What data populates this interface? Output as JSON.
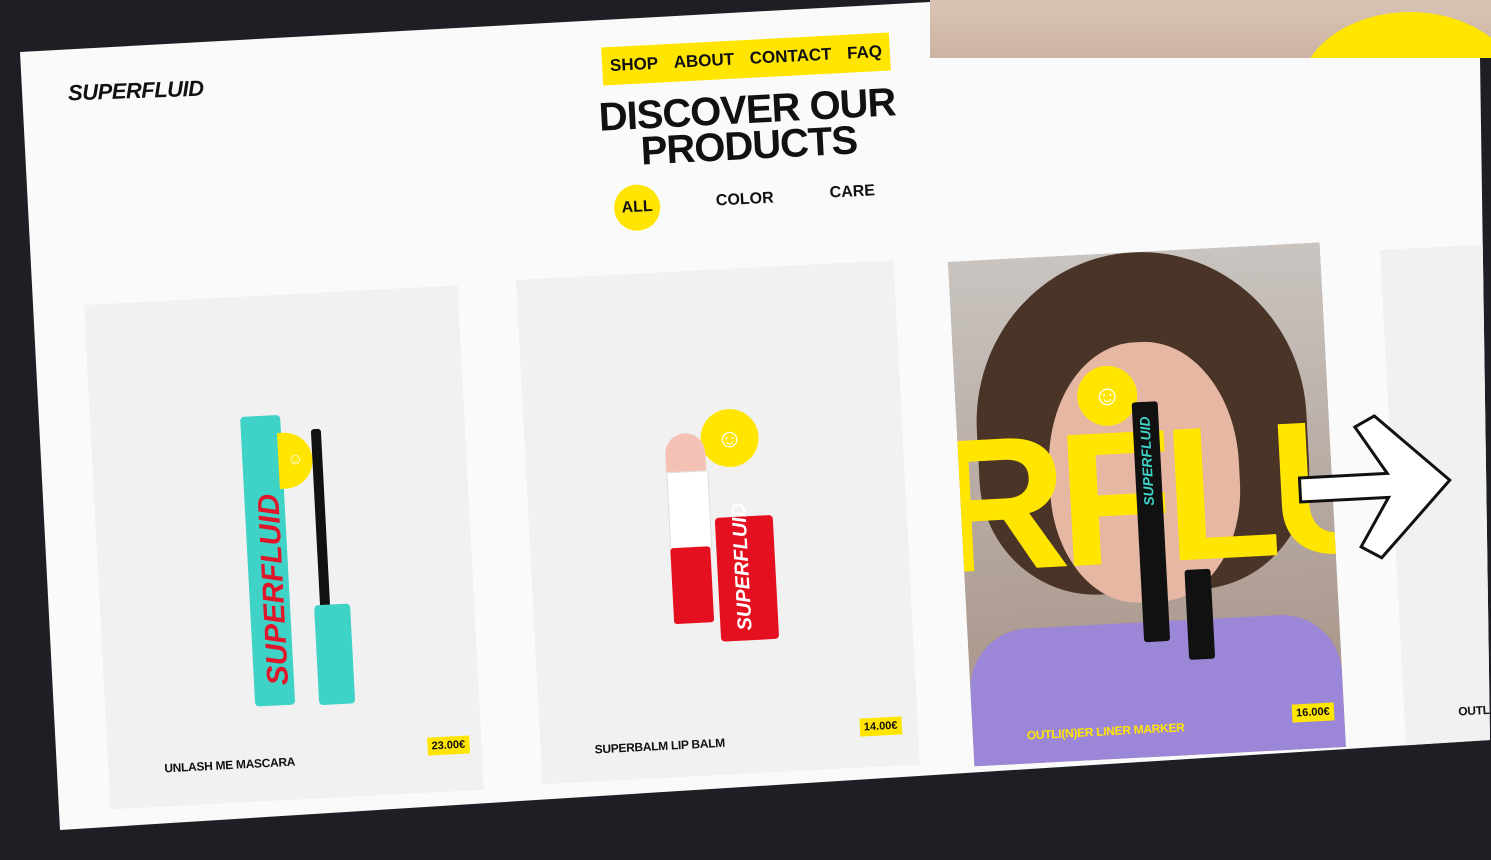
{
  "brand": {
    "logo": "SUPERFLUID"
  },
  "nav": {
    "items": [
      "SHOP",
      "ABOUT",
      "CONTACT",
      "FAQ"
    ]
  },
  "hero": {
    "headline_line1": "DISCOVER OUR",
    "headline_line2": "PRODUCTS"
  },
  "filters": {
    "items": [
      "ALL",
      "COLOR",
      "CARE"
    ],
    "active": "ALL"
  },
  "products": [
    {
      "name": "UNLASH ME MASCARA",
      "price": "23.00€",
      "image_text": "SUPERFLUID"
    },
    {
      "name": "SUPERBALM LIP BALM",
      "price": "14.00€",
      "image_text": "SUPERFLUID"
    },
    {
      "name": "OUTLI(N)ER LINER MARKER",
      "price": "16.00€",
      "image_text": "SUPERFLUID",
      "overlay_text": "RFLU"
    },
    {
      "name": "OUTLI(N)E"
    }
  ],
  "colors": {
    "accent": "#ffe500",
    "background": "#fafafa",
    "frame": "#1e1f24",
    "mascara": "#3fd3c7",
    "brand_red": "#e5101f"
  },
  "icons": [
    "smiley-icon",
    "arrow-right-icon"
  ]
}
